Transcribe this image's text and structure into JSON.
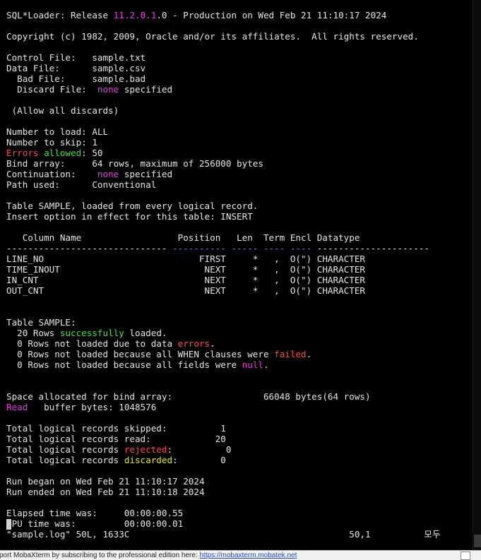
{
  "colors": {
    "default": "#e6e6e6",
    "magenta": "#e040e0",
    "red": "#ff4c4c",
    "green": "#48e048",
    "yellow": "#e6e600",
    "blue": "#4a8af0",
    "accent": "#1a4fc9"
  },
  "terminal": {
    "lines": [
      [
        [
          "SQL*Loader: Release ",
          "default"
        ],
        [
          "11.2.0.1",
          "magenta"
        ],
        [
          ".0 - Production on Wed Feb 21 11:10:17 2024",
          "default"
        ]
      ],
      [],
      [
        [
          "Copyright (c) 1982, 2009, Oracle and/or its affiliates.  All rights reserved.",
          "default"
        ]
      ],
      [],
      [
        [
          "Control File:   sample.txt",
          "default"
        ]
      ],
      [
        [
          "Data File:      sample.csv",
          "default"
        ]
      ],
      [
        [
          "  Bad File:     sample.bad",
          "default"
        ]
      ],
      [
        [
          "  Discard File:  ",
          "default"
        ],
        [
          "none",
          "magenta"
        ],
        [
          " specified",
          "default"
        ]
      ],
      [],
      [
        [
          " (Allow all discards)",
          "default"
        ]
      ],
      [],
      [
        [
          "Number to load: ALL",
          "default"
        ]
      ],
      [
        [
          "Number to skip: 1",
          "default"
        ]
      ],
      [
        [
          "Errors",
          "red"
        ],
        [
          " ",
          "default"
        ],
        [
          "allowed",
          "green"
        ],
        [
          ": 50",
          "default"
        ]
      ],
      [
        [
          "Bind array:     64 rows, maximum of 256000 bytes",
          "default"
        ]
      ],
      [
        [
          "Continuation:    ",
          "default"
        ],
        [
          "none",
          "magenta"
        ],
        [
          " specified",
          "default"
        ]
      ],
      [
        [
          "Path used:      Conventional",
          "default"
        ]
      ],
      [],
      [
        [
          "Table SAMPLE, loaded from every logical record.",
          "default"
        ]
      ],
      [
        [
          "Insert option in effect for this table: INSERT",
          "default"
        ]
      ],
      [],
      [
        [
          "   Column Name                  Position   Len  Term Encl Datatype",
          "default"
        ]
      ],
      [
        [
          "------------------------------ ",
          "default"
        ],
        [
          "---------- ----- ---- ----",
          "blue"
        ],
        [
          " ---------------------",
          "default"
        ]
      ],
      [
        [
          "LINE_NO                             FIRST     *   ,  O(\") CHARACTER",
          "default"
        ]
      ],
      [
        [
          "TIME_INOUT                           NEXT     *   ,  O(\") CHARACTER",
          "default"
        ]
      ],
      [
        [
          "IN_CNT                               NEXT     *   ,  O(\") CHARACTER",
          "default"
        ]
      ],
      [
        [
          "OUT_CNT                              NEXT     *   ,  O(\") CHARACTER",
          "default"
        ]
      ],
      [],
      [],
      [
        [
          "Table SAMPLE:",
          "default"
        ]
      ],
      [
        [
          "  20 Rows ",
          "default"
        ],
        [
          "successfully",
          "green"
        ],
        [
          " loaded.",
          "default"
        ]
      ],
      [
        [
          "  0 Rows not loaded due to data ",
          "default"
        ],
        [
          "errors",
          "red"
        ],
        [
          ".",
          "default"
        ]
      ],
      [
        [
          "  0 Rows not loaded because all WHEN clauses were ",
          "default"
        ],
        [
          "failed",
          "red"
        ],
        [
          ".",
          "default"
        ]
      ],
      [
        [
          "  0 Rows not loaded because all fields were ",
          "default"
        ],
        [
          "null",
          "magenta"
        ],
        [
          ".",
          "default"
        ]
      ],
      [],
      [],
      [
        [
          "Space allocated for bind array:                 66048 bytes(64 rows)",
          "default"
        ]
      ],
      [
        [
          "Read",
          "magenta"
        ],
        [
          "   buffer bytes: 1048576",
          "default"
        ]
      ],
      [],
      [
        [
          "Total logical records skipped:          1",
          "default"
        ]
      ],
      [
        [
          "Total logical records read:            20",
          "default"
        ]
      ],
      [
        [
          "Total logical records ",
          "default"
        ],
        [
          "rejected",
          "red"
        ],
        [
          ":          0",
          "default"
        ]
      ],
      [
        [
          "Total logical records ",
          "default"
        ],
        [
          "discarded",
          "yellow"
        ],
        [
          ":        0",
          "default"
        ]
      ],
      [],
      [
        [
          "Run began on Wed Feb 21 11:10:17 2024",
          "default"
        ]
      ],
      [
        [
          "Run ended on Wed Feb 21 11:10:18 2024",
          "default"
        ]
      ],
      [],
      [
        [
          "Elapsed time was:     00:00:00.55",
          "default"
        ]
      ],
      [
        [
          "CPU time was:         00:00:00.01",
          "default"
        ]
      ],
      [
        [
          "\"sample.log\" 50L, 1633C                                         50,1          모두",
          "default"
        ]
      ]
    ]
  },
  "status_bar": {
    "promo_text": "port MobaXterm by subscribing to the professional edition here:  ",
    "link_text": "https://mobaxterm.mobatek.net"
  }
}
